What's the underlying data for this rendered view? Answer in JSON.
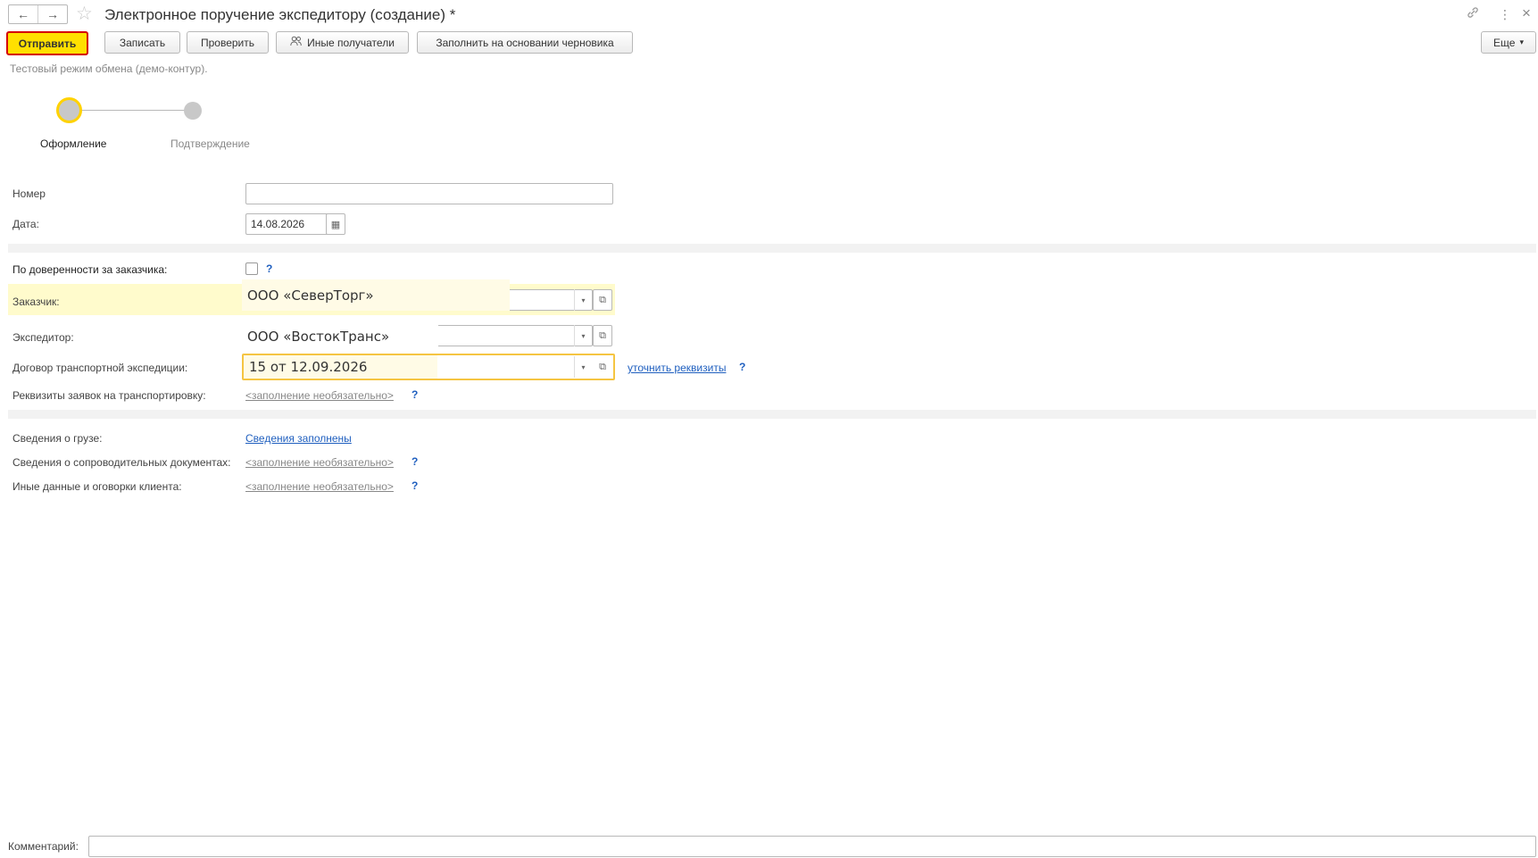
{
  "window": {
    "title": "Электронное поручение экспедитору (создание) *",
    "back_icon": "←",
    "forward_icon": "→",
    "star_icon": "☆",
    "link_icon": "🔗",
    "more_icon": "⋮",
    "close_icon": "×"
  },
  "toolbar": {
    "send": "Отправить",
    "save": "Записать",
    "check": "Проверить",
    "other_recipients": "Иные получатели",
    "fill_from_draft": "Заполнить на основании черновика",
    "more": "Еще",
    "more_arrow": "▾"
  },
  "test_mode": "Тестовый режим обмена (демо-контур).",
  "steps": [
    {
      "label": "Оформление",
      "active": true
    },
    {
      "label": "Подтверждение",
      "active": false
    }
  ],
  "form": {
    "number_label": "Номер",
    "number_value": "",
    "date_label": "Дата:",
    "date_value": "14.08.2026",
    "calendar_icon": "▦",
    "proxy_label": "По доверенности за заказчика:",
    "proxy_checked": false,
    "customer_label": "Заказчик:",
    "customer_value": "ООО «СеверТорг»",
    "forwarder_label": "Экспедитор:",
    "forwarder_value": "ООО «ВостокТранс»",
    "contract_label": "Договор транспортной экспедиции:",
    "contract_value": "15 от 12.09.2026",
    "clarify_link": "уточнить реквизиты",
    "transport_req_label": "Реквизиты заявок на транспортировку:",
    "optional_link": "<заполнение необязательно>",
    "cargo_label": "Сведения о грузе:",
    "cargo_link": "Сведения заполнены",
    "docs_label": "Сведения о сопроводительных документах:",
    "other_label": "Иные данные и оговорки клиента:",
    "help": "?",
    "dropdown_icon": "▾",
    "open_icon": "⧉"
  },
  "comment": {
    "label": "Комментарий:",
    "value": ""
  },
  "colors": {
    "send_bg": "#ffe000",
    "send_border": "#d40000",
    "highlight": "#fffbcc",
    "active_step_ring": "#ffd200",
    "link": "#1f5fbf"
  }
}
